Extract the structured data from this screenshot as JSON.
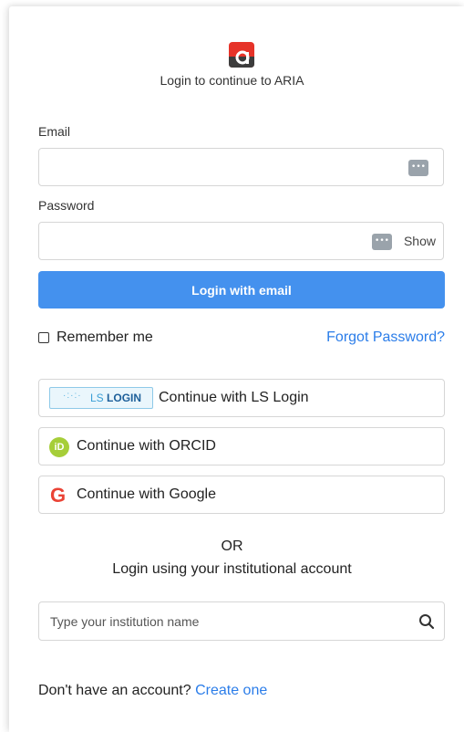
{
  "header": {
    "subtitle": "Login to continue to ARIA",
    "brand_color": "#e63329"
  },
  "form": {
    "email_label": "Email",
    "email_value": "",
    "password_label": "Password",
    "password_value": "",
    "show_label": "Show",
    "login_button": "Login with email",
    "remember_label": "Remember me",
    "remember_checked": false,
    "forgot_link": "Forgot Password?",
    "accent_color": "#4491ee",
    "link_color": "#2b7de9"
  },
  "sso": {
    "ls_badge_prefix": "LS",
    "ls_badge_text": "LOGIN",
    "ls_label": "Continue with LS Login",
    "orcid_icon_text": "iD",
    "orcid_label": "Continue with ORCID",
    "google_icon_text": "G",
    "google_label": "Continue with Google"
  },
  "institution": {
    "or_text": "OR",
    "heading": "Login using your institutional account",
    "placeholder": "Type your institution name"
  },
  "footer": {
    "prompt": "Don't have an account?",
    "create_link": "Create one"
  }
}
